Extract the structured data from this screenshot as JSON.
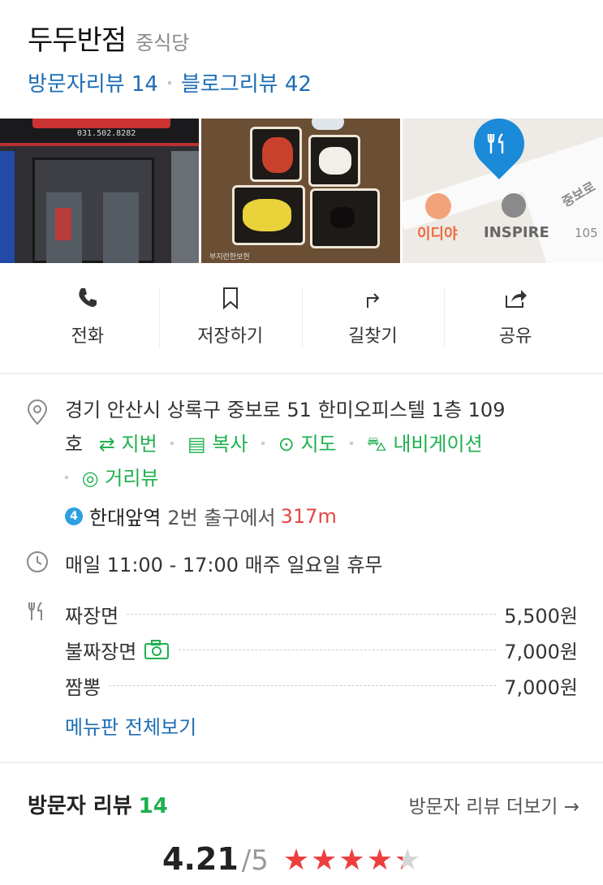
{
  "header": {
    "title": "두두반점",
    "category": "중식당",
    "visitor_review": "방문자리뷰 14",
    "blog_review": "블로그리뷰 42"
  },
  "photos": {
    "store_phone": "031.502.8282",
    "food_credit": "부지런한보현",
    "map_cafe": "이디야",
    "map_place": "INSPIRE",
    "map_street": "중보로",
    "map_number": "105"
  },
  "actions": [
    {
      "label": "전화",
      "icon": "phone-icon"
    },
    {
      "label": "저장하기",
      "icon": "bookmark-icon"
    },
    {
      "label": "길찾기",
      "icon": "directions-icon"
    },
    {
      "label": "공유",
      "icon": "share-icon"
    }
  ],
  "address": {
    "text_line1": "경기 안산시 상록구 중보로 51 한미오피스텔 1층 109",
    "text_line2": "호",
    "links": [
      "지번",
      "복사",
      "지도",
      "내비게이션",
      "거리뷰"
    ]
  },
  "subway": {
    "line": "4",
    "station": "한대앞역",
    "exit": "2번 출구에서",
    "distance": "317m"
  },
  "hours": "매일 11:00 - 17:00 매주 일요일 휴무",
  "menu": {
    "items": [
      {
        "name": "짜장면",
        "price": "5,500원",
        "has_photo": false
      },
      {
        "name": "불짜장면",
        "price": "7,000원",
        "has_photo": true
      },
      {
        "name": "짬뽕",
        "price": "7,000원",
        "has_photo": false
      }
    ],
    "view_all": "메뉴판 전체보기"
  },
  "reviews": {
    "title": "방문자 리뷰",
    "count": "14",
    "more": "방문자 리뷰 더보기 →",
    "score": "4.21",
    "out_of": "/5",
    "stars": 4.21
  },
  "colors": {
    "link_blue": "#1c6db4",
    "green": "#1eb04f",
    "red": "#e64545",
    "star_red": "#ee3e3e"
  }
}
